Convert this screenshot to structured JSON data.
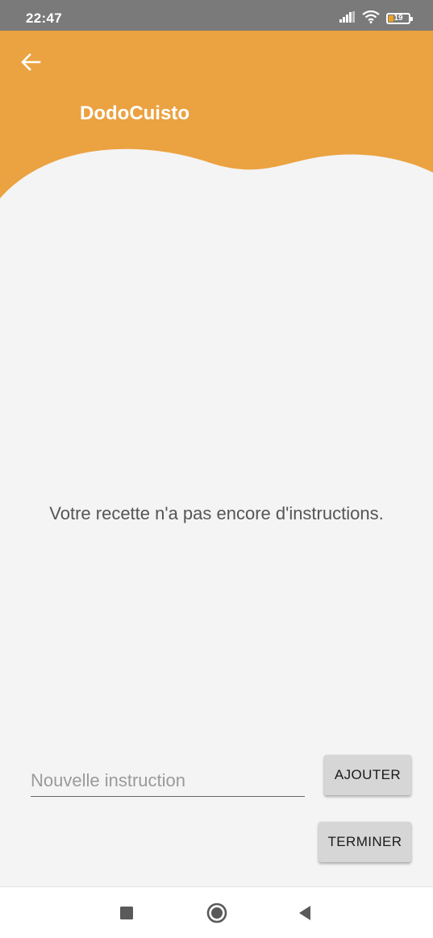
{
  "status_bar": {
    "time": "22:47",
    "battery_level": "19",
    "icons": [
      "signal-icon",
      "wifi-icon",
      "battery-icon"
    ]
  },
  "header": {
    "title": "DodoCuisto",
    "back_icon": "arrow-left-icon",
    "color": "#eba241"
  },
  "main": {
    "empty_message": "Votre recette n'a pas encore d'instructions."
  },
  "form": {
    "instruction_input": {
      "value": "",
      "placeholder": "Nouvelle instruction"
    },
    "add_button_label": "AJOUTER",
    "finish_button_label": "TERMINER"
  },
  "nav_bar": {
    "icons": [
      "recents-icon",
      "home-icon",
      "back-icon"
    ]
  }
}
